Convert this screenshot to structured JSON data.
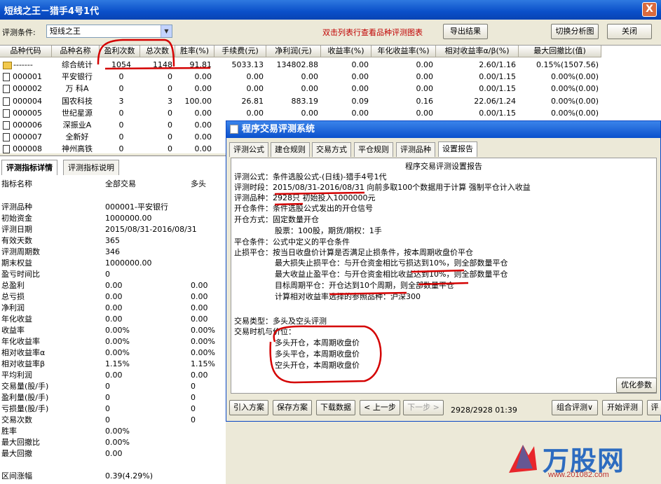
{
  "window": {
    "title": "短线之王－猎手4号1代",
    "close": "X"
  },
  "toolbar": {
    "condition_label": "评测条件:",
    "condition_value": "短线之王",
    "hint": "双击列表行查看品种评测图表",
    "export_btn": "导出结果",
    "switch_btn": "切换分析图",
    "close_btn": "关闭"
  },
  "grid": {
    "headers": [
      "品种代码",
      "品种名称",
      "盈利次数",
      "总次数",
      "胜率(%)",
      "手续费(元)",
      "净利润(元)",
      "收益率(%)",
      "年化收益率(%)",
      "相对收益率α/β(%)",
      "最大回撤比(值)"
    ],
    "rows": [
      [
        "-------",
        "综合统计",
        "1054",
        "1148",
        "91.81",
        "5033.13",
        "134802.88",
        "0.00",
        "0.00",
        "2.60/1.16",
        "0.15%(1507.56)"
      ],
      [
        "000001",
        "平安银行",
        "0",
        "0",
        "0.00",
        "0.00",
        "0.00",
        "0.00",
        "0.00",
        "0.00/1.15",
        "0.00%(0.00)"
      ],
      [
        "000002",
        "万 科A",
        "0",
        "0",
        "0.00",
        "0.00",
        "0.00",
        "0.00",
        "0.00",
        "0.00/1.15",
        "0.00%(0.00)"
      ],
      [
        "000004",
        "国农科技",
        "3",
        "3",
        "100.00",
        "26.81",
        "883.19",
        "0.09",
        "0.16",
        "22.06/1.24",
        "0.00%(0.00)"
      ],
      [
        "000005",
        "世纪星源",
        "0",
        "0",
        "0.00",
        "0.00",
        "0.00",
        "0.00",
        "0.00",
        "0.00/1.15",
        "0.00%(0.00)"
      ],
      [
        "000006",
        "深振业A",
        "0",
        "0",
        "0.00",
        "",
        "",
        "",
        "",
        "",
        ""
      ],
      [
        "000007",
        "全新好",
        "0",
        "0",
        "0.00",
        "",
        "",
        "",
        "",
        "",
        ""
      ],
      [
        "000008",
        "神州高铁",
        "0",
        "0",
        "0.00",
        "",
        "",
        "",
        "",
        "",
        ""
      ]
    ]
  },
  "left": {
    "tabs": [
      "评测指标详情",
      "评测指标说明"
    ],
    "columns": [
      "指标名称",
      "全部交易",
      "多头"
    ],
    "rows": [
      [
        "评测品种",
        "000001-平安银行",
        ""
      ],
      [
        "初始资金",
        "1000000.00",
        ""
      ],
      [
        "评测日期",
        "2015/08/31-2016/08/31",
        ""
      ],
      [
        "有效天数",
        "365",
        ""
      ],
      [
        "评测周期数",
        "346",
        ""
      ],
      [
        "期末权益",
        "1000000.00",
        ""
      ],
      [
        "盈亏时间比",
        "0",
        ""
      ],
      [
        "总盈利",
        "0.00",
        "0.00"
      ],
      [
        "总亏损",
        "0.00",
        "0.00"
      ],
      [
        "净利润",
        "0.00",
        "0.00"
      ],
      [
        "年化收益",
        "0.00",
        "0.00"
      ],
      [
        "收益率",
        "0.00%",
        "0.00%"
      ],
      [
        "年化收益率",
        "0.00%",
        "0.00%"
      ],
      [
        "相对收益率α",
        "0.00%",
        "0.00%"
      ],
      [
        "相对收益率β",
        "1.15%",
        "1.15%"
      ],
      [
        "平均利润",
        "0.00",
        "0.00"
      ],
      [
        "交易量(股/手)",
        "0",
        "0"
      ],
      [
        "盈利量(股/手)",
        "0",
        "0"
      ],
      [
        "亏损量(股/手)",
        "0",
        "0"
      ],
      [
        "交易次数",
        "0",
        "0"
      ],
      [
        "胜率",
        "0.00%",
        ""
      ],
      [
        "最大回撤比",
        "0.00%",
        ""
      ],
      [
        "最大回撤",
        "0.00",
        ""
      ],
      [
        "",
        "",
        " "
      ],
      [
        "区间涨幅",
        "0.39(4.29%)",
        ""
      ]
    ]
  },
  "dialog": {
    "title": "程序交易评测系统",
    "tabs": [
      "评测公式",
      "建仓规则",
      "交易方式",
      "平仓规则",
      "评测品种",
      "设置报告"
    ],
    "report_title": "程序交易评测设置报告",
    "lines": [
      "评测公式：条件选股公式-(日线)-猎手4号1代",
      "评测时段：2015/08/31-2016/08/31 向前多取100个数据用于计算 强制平仓计入收益",
      "评测品种：2928只 初始投入1000000元",
      "开仓条件：条件选股公式发出的开仓信号",
      "开仓方式：固定数量开仓",
      "股票：100股，期货/期权：1手",
      "平仓条件：公式中定义的平仓条件",
      "止损平仓：按当日收盘价计算是否满足止损条件，按本周期收盘价平仓",
      "最大损失止损平仓：与开仓资金相比亏损达到10%，则全部数量平仓",
      "最大收益止盈平仓：与开仓资金相比收益达到10%，则全部数量平仓",
      "目标周期平仓：开仓达到10个周期，则全部数量平仓",
      "计算相对收益率选择的参照品种：沪深300",
      "交易类型：多头及空头评测",
      "交易时机与价位：",
      "多头开仓，本周期收盘价",
      "多头平仓，本周期收盘价",
      "空头开仓，本周期收盘价"
    ],
    "optimize_btn": "优化参数",
    "buttons": [
      "引入方案",
      "保存方案",
      "下载数据",
      "< 上一步",
      "下一步 >"
    ],
    "progress": "2928/2928  01:39",
    "right_buttons": [
      "组合评测∨",
      "开始评测",
      "评"
    ]
  },
  "watermark": {
    "logo": "万股网",
    "url": "www.201082.com"
  },
  "colors": {
    "title_blue": "#0a50cc",
    "hint_red": "#c00000",
    "annotation_red": "#d40000"
  }
}
